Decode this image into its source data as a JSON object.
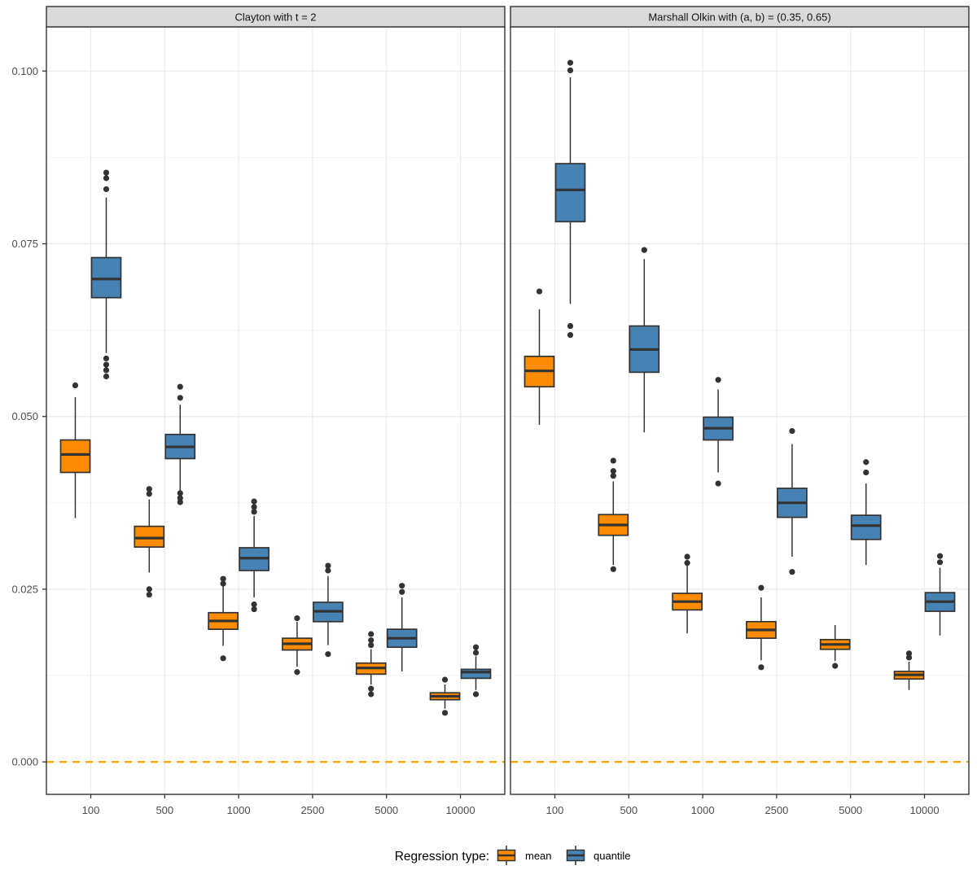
{
  "chart_data": {
    "type": "boxplot",
    "orientation": "vertical",
    "categories": [
      "100",
      "500",
      "1000",
      "2500",
      "5000",
      "10000"
    ],
    "y_ticks": [
      "0.000",
      "0.025",
      "0.050",
      "0.075",
      "0.100"
    ],
    "y_tick_values": [
      0,
      0.025,
      0.05,
      0.075,
      0.1
    ],
    "ylim": [
      -0.0047,
      0.1064
    ],
    "grid": "on",
    "reference_line": {
      "y": 0,
      "color": "#FFA500",
      "style": "dashed"
    },
    "style": {
      "stroke": "#333333",
      "grid_major": "#EBEBEB",
      "grid_minor": "#F4F4F4",
      "strip_fill": "#D9D9D9",
      "axis_text": "#4D4D4D",
      "mean_color": "#FF8C00",
      "quantile_color": "#4682B4"
    },
    "legend": {
      "title": "Regression type:",
      "position": "bottom",
      "entries": [
        {
          "label": "mean",
          "color": "#FF8C00"
        },
        {
          "label": "quantile",
          "color": "#4682B4"
        }
      ]
    },
    "facets": [
      {
        "title": "Clayton with t = 2",
        "series": [
          {
            "name": "mean",
            "color": "#FF8C00",
            "boxes": [
              {
                "category": "100",
                "whisker_low": 0.0353,
                "q1": 0.0419,
                "median": 0.0445,
                "q3": 0.0466,
                "whisker_high": 0.0528,
                "outliers": [
                  0.0545
                ]
              },
              {
                "category": "500",
                "whisker_low": 0.0274,
                "q1": 0.0311,
                "median": 0.0324,
                "q3": 0.0341,
                "whisker_high": 0.038,
                "outliers": [
                  0.0395,
                  0.0388,
                  0.025,
                  0.0242
                ]
              },
              {
                "category": "1000",
                "whisker_low": 0.0168,
                "q1": 0.0192,
                "median": 0.0204,
                "q3": 0.0216,
                "whisker_high": 0.0254,
                "outliers": [
                  0.0265,
                  0.0258,
                  0.015
                ]
              },
              {
                "category": "2500",
                "whisker_low": 0.0138,
                "q1": 0.0162,
                "median": 0.0171,
                "q3": 0.0179,
                "whisker_high": 0.0203,
                "outliers": [
                  0.0208,
                  0.013
                ]
              },
              {
                "category": "5000",
                "whisker_low": 0.0112,
                "q1": 0.0127,
                "median": 0.0136,
                "q3": 0.0143,
                "whisker_high": 0.0163,
                "outliers": [
                  0.0185,
                  0.0176,
                  0.0169,
                  0.0106,
                  0.0098
                ]
              },
              {
                "category": "10000",
                "whisker_low": 0.0077,
                "q1": 0.009,
                "median": 0.0095,
                "q3": 0.01,
                "whisker_high": 0.0112,
                "outliers": [
                  0.0119,
                  0.0071
                ]
              }
            ]
          },
          {
            "name": "quantile",
            "color": "#4682B4",
            "boxes": [
              {
                "category": "100",
                "whisker_low": 0.0592,
                "q1": 0.0672,
                "median": 0.0699,
                "q3": 0.073,
                "whisker_high": 0.0817,
                "outliers": [
                  0.0853,
                  0.0845,
                  0.0829,
                  0.0584,
                  0.0575,
                  0.0567,
                  0.0558
                ]
              },
              {
                "category": "500",
                "whisker_low": 0.0392,
                "q1": 0.0439,
                "median": 0.0456,
                "q3": 0.0474,
                "whisker_high": 0.0517,
                "outliers": [
                  0.0543,
                  0.0527,
                  0.0389,
                  0.0382,
                  0.0376
                ]
              },
              {
                "category": "1000",
                "whisker_low": 0.0238,
                "q1": 0.0277,
                "median": 0.0295,
                "q3": 0.031,
                "whisker_high": 0.0356,
                "outliers": [
                  0.0377,
                  0.0369,
                  0.0362,
                  0.0228,
                  0.0221
                ]
              },
              {
                "category": "2500",
                "whisker_low": 0.0169,
                "q1": 0.0203,
                "median": 0.0218,
                "q3": 0.0231,
                "whisker_high": 0.0269,
                "outliers": [
                  0.0284,
                  0.0277,
                  0.0156
                ]
              },
              {
                "category": "5000",
                "whisker_low": 0.0131,
                "q1": 0.0166,
                "median": 0.0179,
                "q3": 0.0192,
                "whisker_high": 0.0238,
                "outliers": [
                  0.0255,
                  0.0246
                ]
              },
              {
                "category": "10000",
                "whisker_low": 0.0104,
                "q1": 0.0121,
                "median": 0.013,
                "q3": 0.0134,
                "whisker_high": 0.0153,
                "outliers": [
                  0.0166,
                  0.0158,
                  0.0098
                ]
              }
            ]
          }
        ]
      },
      {
        "title": "Marshall Olkin with (a, b) = (0.35, 0.65)",
        "series": [
          {
            "name": "mean",
            "color": "#FF8C00",
            "boxes": [
              {
                "category": "100",
                "whisker_low": 0.0488,
                "q1": 0.0543,
                "median": 0.0566,
                "q3": 0.0587,
                "whisker_high": 0.0655,
                "outliers": [
                  0.0681
                ]
              },
              {
                "category": "500",
                "whisker_low": 0.0285,
                "q1": 0.0328,
                "median": 0.0343,
                "q3": 0.0358,
                "whisker_high": 0.0406,
                "outliers": [
                  0.0436,
                  0.0421,
                  0.0414,
                  0.0279
                ]
              },
              {
                "category": "1000",
                "whisker_low": 0.0186,
                "q1": 0.022,
                "median": 0.0232,
                "q3": 0.0244,
                "whisker_high": 0.0285,
                "outliers": [
                  0.0297,
                  0.0288
                ]
              },
              {
                "category": "2500",
                "whisker_low": 0.0147,
                "q1": 0.0179,
                "median": 0.0191,
                "q3": 0.0203,
                "whisker_high": 0.0238,
                "outliers": [
                  0.0252,
                  0.0137
                ]
              },
              {
                "category": "5000",
                "whisker_low": 0.0146,
                "q1": 0.0163,
                "median": 0.017,
                "q3": 0.0177,
                "whisker_high": 0.0198,
                "outliers": [
                  0.0139
                ]
              },
              {
                "category": "10000",
                "whisker_low": 0.0104,
                "q1": 0.012,
                "median": 0.0126,
                "q3": 0.0131,
                "whisker_high": 0.0145,
                "outliers": [
                  0.0157,
                  0.0151
                ]
              }
            ]
          },
          {
            "name": "quantile",
            "color": "#4682B4",
            "boxes": [
              {
                "category": "100",
                "whisker_low": 0.0663,
                "q1": 0.0782,
                "median": 0.0828,
                "q3": 0.0866,
                "whisker_high": 0.0991,
                "outliers": [
                  0.1012,
                  0.1001,
                  0.0631,
                  0.0618
                ]
              },
              {
                "category": "500",
                "whisker_low": 0.0477,
                "q1": 0.0564,
                "median": 0.0597,
                "q3": 0.0631,
                "whisker_high": 0.0728,
                "outliers": [
                  0.0741
                ]
              },
              {
                "category": "1000",
                "whisker_low": 0.0419,
                "q1": 0.0466,
                "median": 0.0483,
                "q3": 0.0499,
                "whisker_high": 0.0539,
                "outliers": [
                  0.0553,
                  0.0403
                ]
              },
              {
                "category": "2500",
                "whisker_low": 0.0297,
                "q1": 0.0354,
                "median": 0.0375,
                "q3": 0.0396,
                "whisker_high": 0.046,
                "outliers": [
                  0.0479,
                  0.0275
                ]
              },
              {
                "category": "5000",
                "whisker_low": 0.0285,
                "q1": 0.0322,
                "median": 0.0342,
                "q3": 0.0357,
                "whisker_high": 0.0403,
                "outliers": [
                  0.0434,
                  0.0419
                ]
              },
              {
                "category": "10000",
                "whisker_low": 0.0183,
                "q1": 0.0218,
                "median": 0.0232,
                "q3": 0.0245,
                "whisker_high": 0.0281,
                "outliers": [
                  0.0298,
                  0.0289
                ]
              }
            ]
          }
        ]
      }
    ]
  }
}
